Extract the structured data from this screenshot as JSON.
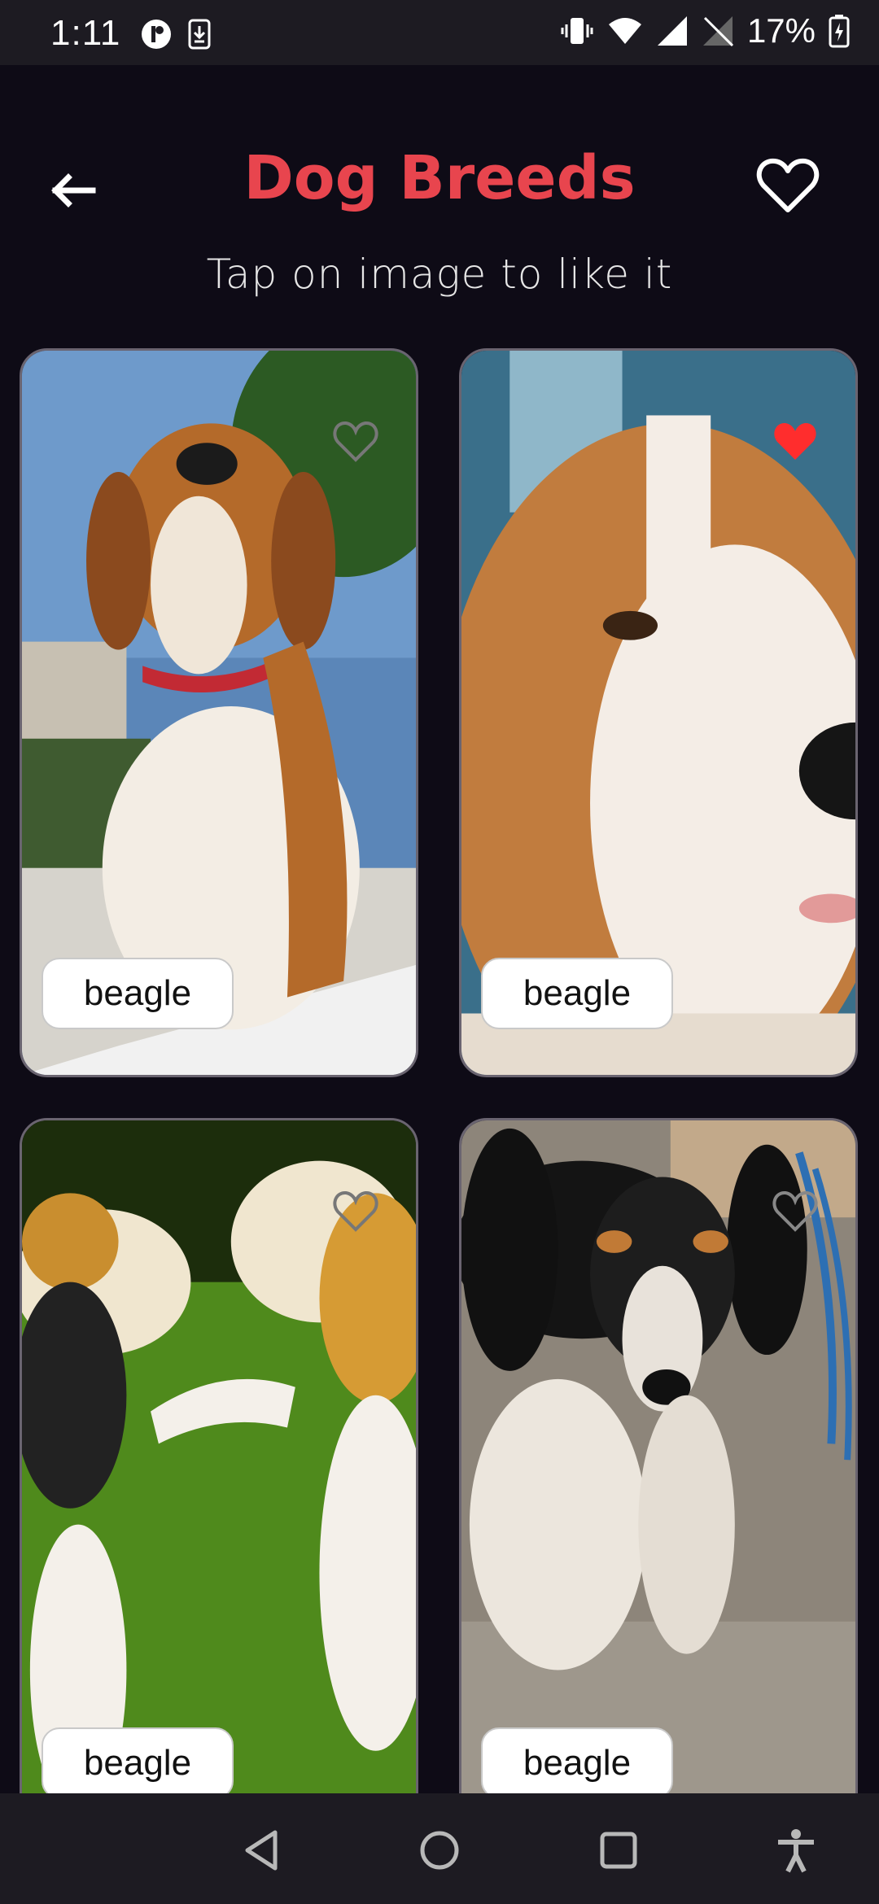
{
  "status": {
    "time": "1:11",
    "battery": "17%"
  },
  "header": {
    "title": "Dog Breeds",
    "subtitle": "Tap on image to like it"
  },
  "cards": [
    {
      "breed": "beagle",
      "liked": false
    },
    {
      "breed": "beagle",
      "liked": true
    },
    {
      "breed": "beagle",
      "liked": false
    },
    {
      "breed": "beagle",
      "liked": false
    }
  ],
  "colors": {
    "accent": "#e8454e",
    "liked_heart": "#ff2d2d",
    "background": "#0e0b16"
  }
}
